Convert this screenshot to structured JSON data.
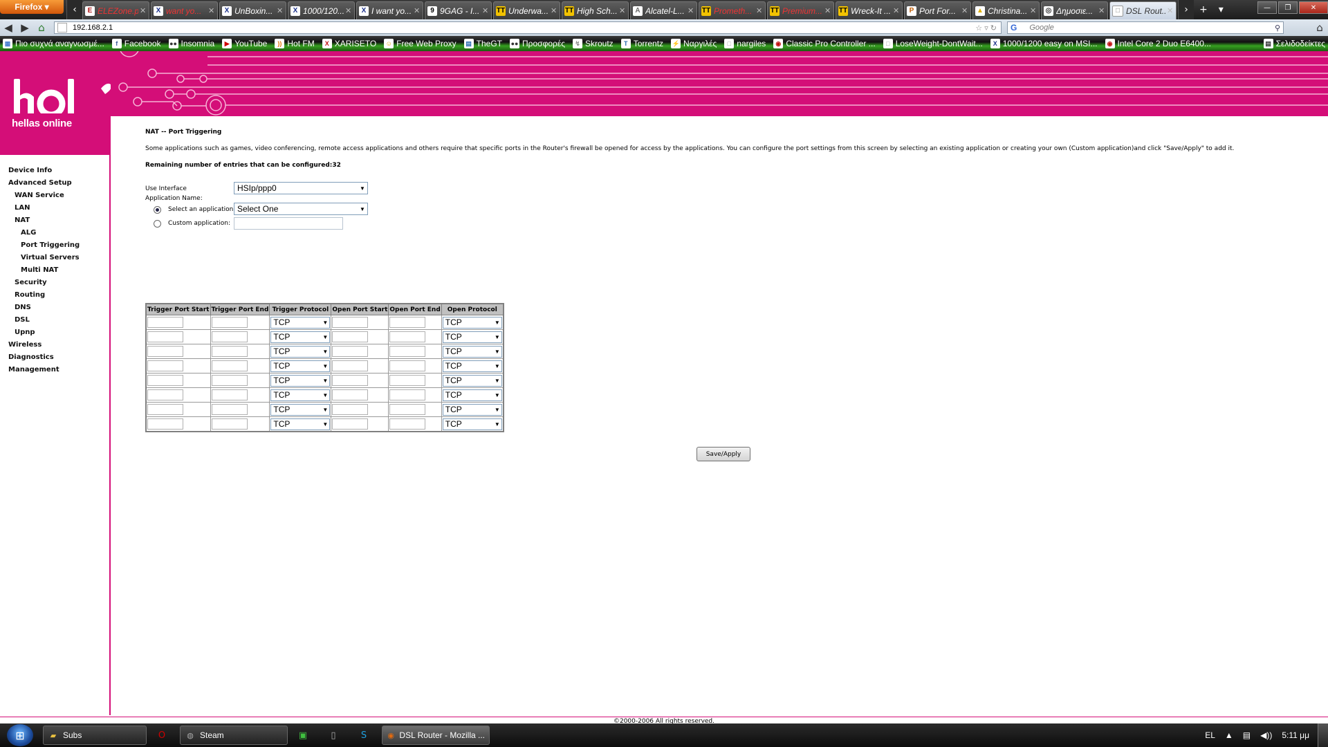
{
  "browser": {
    "menu_button": "Firefox",
    "tabs": [
      {
        "title": "ELEZone.p...",
        "icon": "E",
        "icon_color": "#b01818"
      },
      {
        "title": "want yo...",
        "icon": "X",
        "icon_color": "#1a2f8a"
      },
      {
        "title": "UnBoxin...",
        "icon": "X",
        "icon_color": "#1a2f8a"
      },
      {
        "title": "1000/120...",
        "icon": "X",
        "icon_color": "#1a2f8a"
      },
      {
        "title": "I want yo...",
        "icon": "X",
        "icon_color": "#1a2f8a"
      },
      {
        "title": "9GAG - I...",
        "icon": "9",
        "icon_color": "#000000"
      },
      {
        "title": "Underwa...",
        "icon": "TT",
        "icon_color": "#f2c200"
      },
      {
        "title": "High Sch...",
        "icon": "TT",
        "icon_color": "#f2c200"
      },
      {
        "title": "Alcatel-L...",
        "icon": "A",
        "icon_color": "#6b6b6b"
      },
      {
        "title": "Prometh...",
        "icon": "TT",
        "icon_color": "#f2c200"
      },
      {
        "title": "Premium...",
        "icon": "TT",
        "icon_color": "#f2c200"
      },
      {
        "title": "Wreck-It ...",
        "icon": "TT",
        "icon_color": "#f2c200"
      },
      {
        "title": "Port For...",
        "icon": "P",
        "icon_color": "#c05a00"
      },
      {
        "title": "Christina...",
        "icon": "▲",
        "icon_color": "#e0b000"
      },
      {
        "title": "Δημοσιε...",
        "icon": "◎",
        "icon_color": "#333333"
      },
      {
        "title": "DSL Rout...",
        "icon": "□",
        "icon_color": "#ffffff"
      }
    ],
    "url": "192.168.2.1",
    "search_placeholder": "Google",
    "search_engine": "G",
    "bookmarks": [
      {
        "label": "Πιο συχνά αναγνωσμέ...",
        "icon": "▦",
        "color": "#4a7fd0"
      },
      {
        "label": "Facebook",
        "icon": "f",
        "color": "#3b5998"
      },
      {
        "label": "Insomnia",
        "icon": "●●",
        "color": "#333333"
      },
      {
        "label": "YouTube",
        "icon": "▶",
        "color": "#d00000"
      },
      {
        "label": "Hot FM",
        "icon": "))",
        "color": "#e07000"
      },
      {
        "label": "XARISETO",
        "icon": "X",
        "color": "#c01010"
      },
      {
        "label": "Free Web Proxy",
        "icon": "☺",
        "color": "#e0a000"
      },
      {
        "label": "TheGT",
        "icon": "▤",
        "color": "#2b6cb0"
      },
      {
        "label": "Προσφορές",
        "icon": "●●",
        "color": "#333333"
      },
      {
        "label": "Skroutz",
        "icon": "↯",
        "color": "#888888"
      },
      {
        "label": "Torrentz",
        "icon": "T",
        "color": "#2b6cb0"
      },
      {
        "label": "Ναργιλές",
        "icon": "⚡",
        "color": "#e0a000"
      },
      {
        "label": "nargiles",
        "icon": "□",
        "color": "#999999"
      },
      {
        "label": "Classic Pro Controller ...",
        "icon": "◉",
        "color": "#c01010"
      },
      {
        "label": "LoseWeight-DontWait...",
        "icon": "□",
        "color": "#999999"
      },
      {
        "label": "1000/1200 easy on MSI...",
        "icon": "X",
        "color": "#1a2f8a"
      },
      {
        "label": "Intel Core 2 Duo E6400...",
        "icon": "◉",
        "color": "#c01010"
      }
    ],
    "bookmarks_menu": "Σελιδοδείκτες"
  },
  "router": {
    "brand": "hol",
    "brand_sub": "hellas online",
    "menu": [
      {
        "label": "Device Info",
        "level": 0
      },
      {
        "label": "Advanced Setup",
        "level": 0
      },
      {
        "label": "WAN Service",
        "level": 1
      },
      {
        "label": "LAN",
        "level": 1
      },
      {
        "label": "NAT",
        "level": 1
      },
      {
        "label": "ALG",
        "level": 2
      },
      {
        "label": "Port Triggering",
        "level": 2
      },
      {
        "label": "Virtual Servers",
        "level": 2
      },
      {
        "label": "Multi NAT",
        "level": 2
      },
      {
        "label": "Security",
        "level": 1
      },
      {
        "label": "Routing",
        "level": 1
      },
      {
        "label": "DNS",
        "level": 1
      },
      {
        "label": "DSL",
        "level": 1
      },
      {
        "label": "Upnp",
        "level": 1
      },
      {
        "label": "Wireless",
        "level": 0
      },
      {
        "label": "Diagnostics",
        "level": 0
      },
      {
        "label": "Management",
        "level": 0
      }
    ],
    "page_title": "NAT -- Port Triggering",
    "description": "Some applications such as games, video conferencing, remote access applications and others require that specific ports in the Router's firewall be opened for access by the applications. You can configure the port settings from this screen by selecting an existing application or creating your own (Custom application)and click \"Save/Apply\" to add it.",
    "remaining": "Remaining number of entries that can be configured:32",
    "use_interface_label": "Use Interface",
    "use_interface_value": "HSIp/ppp0",
    "application_name_label": "Application Name:",
    "select_app_label": "Select an application:",
    "select_app_value": "Select One",
    "custom_app_label": "Custom application:",
    "table_headers": [
      "Trigger Port Start",
      "Trigger Port End",
      "Trigger Protocol",
      "Open Port Start",
      "Open Port End",
      "Open Protocol"
    ],
    "rows": [
      {
        "trigger_protocol": "TCP",
        "open_protocol": "TCP"
      },
      {
        "trigger_protocol": "TCP",
        "open_protocol": "TCP"
      },
      {
        "trigger_protocol": "TCP",
        "open_protocol": "TCP"
      },
      {
        "trigger_protocol": "TCP",
        "open_protocol": "TCP"
      },
      {
        "trigger_protocol": "TCP",
        "open_protocol": "TCP"
      },
      {
        "trigger_protocol": "TCP",
        "open_protocol": "TCP"
      },
      {
        "trigger_protocol": "TCP",
        "open_protocol": "TCP"
      },
      {
        "trigger_protocol": "TCP",
        "open_protocol": "TCP"
      }
    ],
    "save_label": "Save/Apply",
    "footer": "©2000-2006 All rights reserved.",
    "brand_color": "#d40e78"
  },
  "taskbar": {
    "tasks": [
      {
        "label": "Subs",
        "icon": "▰",
        "color": "#e8c040",
        "active": false
      },
      {
        "label": "Steam",
        "icon": "◍",
        "color": "#aaaaaa",
        "active": false
      },
      {
        "label": "DSL Router - Mozilla ...",
        "icon": "◉",
        "color": "#e06a10",
        "active": true
      }
    ],
    "pins": [
      {
        "icon": "O",
        "color": "#d00000",
        "name": "opera-icon"
      },
      {
        "icon": "▣",
        "color": "#40c040",
        "name": "utorrent-icon"
      },
      {
        "icon": "▯",
        "color": "#aaaaaa",
        "name": "notepad-icon"
      },
      {
        "icon": "S",
        "color": "#1ea0e0",
        "name": "skype-icon"
      }
    ],
    "language": "EL",
    "clock": "5:11 μμ"
  }
}
